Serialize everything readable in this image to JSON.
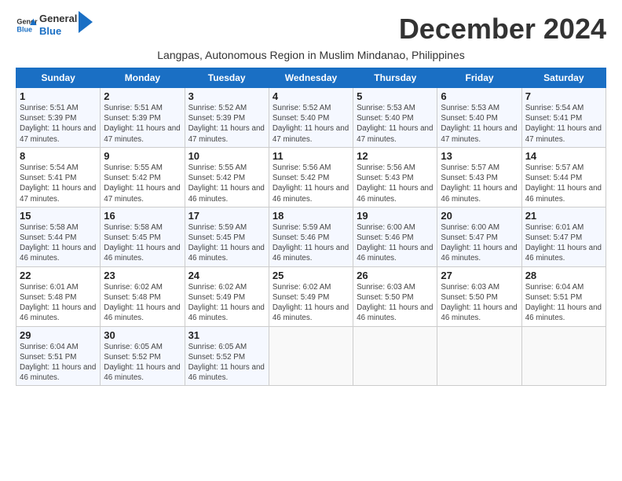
{
  "header": {
    "logo_line1": "General",
    "logo_line2": "Blue",
    "month_title": "December 2024",
    "subtitle": "Langpas, Autonomous Region in Muslim Mindanao, Philippines"
  },
  "weekdays": [
    "Sunday",
    "Monday",
    "Tuesday",
    "Wednesday",
    "Thursday",
    "Friday",
    "Saturday"
  ],
  "weeks": [
    [
      {
        "day": "1",
        "sunrise": "Sunrise: 5:51 AM",
        "sunset": "Sunset: 5:39 PM",
        "daylight": "Daylight: 11 hours and 47 minutes."
      },
      {
        "day": "2",
        "sunrise": "Sunrise: 5:51 AM",
        "sunset": "Sunset: 5:39 PM",
        "daylight": "Daylight: 11 hours and 47 minutes."
      },
      {
        "day": "3",
        "sunrise": "Sunrise: 5:52 AM",
        "sunset": "Sunset: 5:39 PM",
        "daylight": "Daylight: 11 hours and 47 minutes."
      },
      {
        "day": "4",
        "sunrise": "Sunrise: 5:52 AM",
        "sunset": "Sunset: 5:40 PM",
        "daylight": "Daylight: 11 hours and 47 minutes."
      },
      {
        "day": "5",
        "sunrise": "Sunrise: 5:53 AM",
        "sunset": "Sunset: 5:40 PM",
        "daylight": "Daylight: 11 hours and 47 minutes."
      },
      {
        "day": "6",
        "sunrise": "Sunrise: 5:53 AM",
        "sunset": "Sunset: 5:40 PM",
        "daylight": "Daylight: 11 hours and 47 minutes."
      },
      {
        "day": "7",
        "sunrise": "Sunrise: 5:54 AM",
        "sunset": "Sunset: 5:41 PM",
        "daylight": "Daylight: 11 hours and 47 minutes."
      }
    ],
    [
      {
        "day": "8",
        "sunrise": "Sunrise: 5:54 AM",
        "sunset": "Sunset: 5:41 PM",
        "daylight": "Daylight: 11 hours and 47 minutes."
      },
      {
        "day": "9",
        "sunrise": "Sunrise: 5:55 AM",
        "sunset": "Sunset: 5:42 PM",
        "daylight": "Daylight: 11 hours and 47 minutes."
      },
      {
        "day": "10",
        "sunrise": "Sunrise: 5:55 AM",
        "sunset": "Sunset: 5:42 PM",
        "daylight": "Daylight: 11 hours and 46 minutes."
      },
      {
        "day": "11",
        "sunrise": "Sunrise: 5:56 AM",
        "sunset": "Sunset: 5:42 PM",
        "daylight": "Daylight: 11 hours and 46 minutes."
      },
      {
        "day": "12",
        "sunrise": "Sunrise: 5:56 AM",
        "sunset": "Sunset: 5:43 PM",
        "daylight": "Daylight: 11 hours and 46 minutes."
      },
      {
        "day": "13",
        "sunrise": "Sunrise: 5:57 AM",
        "sunset": "Sunset: 5:43 PM",
        "daylight": "Daylight: 11 hours and 46 minutes."
      },
      {
        "day": "14",
        "sunrise": "Sunrise: 5:57 AM",
        "sunset": "Sunset: 5:44 PM",
        "daylight": "Daylight: 11 hours and 46 minutes."
      }
    ],
    [
      {
        "day": "15",
        "sunrise": "Sunrise: 5:58 AM",
        "sunset": "Sunset: 5:44 PM",
        "daylight": "Daylight: 11 hours and 46 minutes."
      },
      {
        "day": "16",
        "sunrise": "Sunrise: 5:58 AM",
        "sunset": "Sunset: 5:45 PM",
        "daylight": "Daylight: 11 hours and 46 minutes."
      },
      {
        "day": "17",
        "sunrise": "Sunrise: 5:59 AM",
        "sunset": "Sunset: 5:45 PM",
        "daylight": "Daylight: 11 hours and 46 minutes."
      },
      {
        "day": "18",
        "sunrise": "Sunrise: 5:59 AM",
        "sunset": "Sunset: 5:46 PM",
        "daylight": "Daylight: 11 hours and 46 minutes."
      },
      {
        "day": "19",
        "sunrise": "Sunrise: 6:00 AM",
        "sunset": "Sunset: 5:46 PM",
        "daylight": "Daylight: 11 hours and 46 minutes."
      },
      {
        "day": "20",
        "sunrise": "Sunrise: 6:00 AM",
        "sunset": "Sunset: 5:47 PM",
        "daylight": "Daylight: 11 hours and 46 minutes."
      },
      {
        "day": "21",
        "sunrise": "Sunrise: 6:01 AM",
        "sunset": "Sunset: 5:47 PM",
        "daylight": "Daylight: 11 hours and 46 minutes."
      }
    ],
    [
      {
        "day": "22",
        "sunrise": "Sunrise: 6:01 AM",
        "sunset": "Sunset: 5:48 PM",
        "daylight": "Daylight: 11 hours and 46 minutes."
      },
      {
        "day": "23",
        "sunrise": "Sunrise: 6:02 AM",
        "sunset": "Sunset: 5:48 PM",
        "daylight": "Daylight: 11 hours and 46 minutes."
      },
      {
        "day": "24",
        "sunrise": "Sunrise: 6:02 AM",
        "sunset": "Sunset: 5:49 PM",
        "daylight": "Daylight: 11 hours and 46 minutes."
      },
      {
        "day": "25",
        "sunrise": "Sunrise: 6:02 AM",
        "sunset": "Sunset: 5:49 PM",
        "daylight": "Daylight: 11 hours and 46 minutes."
      },
      {
        "day": "26",
        "sunrise": "Sunrise: 6:03 AM",
        "sunset": "Sunset: 5:50 PM",
        "daylight": "Daylight: 11 hours and 46 minutes."
      },
      {
        "day": "27",
        "sunrise": "Sunrise: 6:03 AM",
        "sunset": "Sunset: 5:50 PM",
        "daylight": "Daylight: 11 hours and 46 minutes."
      },
      {
        "day": "28",
        "sunrise": "Sunrise: 6:04 AM",
        "sunset": "Sunset: 5:51 PM",
        "daylight": "Daylight: 11 hours and 46 minutes."
      }
    ],
    [
      {
        "day": "29",
        "sunrise": "Sunrise: 6:04 AM",
        "sunset": "Sunset: 5:51 PM",
        "daylight": "Daylight: 11 hours and 46 minutes."
      },
      {
        "day": "30",
        "sunrise": "Sunrise: 6:05 AM",
        "sunset": "Sunset: 5:52 PM",
        "daylight": "Daylight: 11 hours and 46 minutes."
      },
      {
        "day": "31",
        "sunrise": "Sunrise: 6:05 AM",
        "sunset": "Sunset: 5:52 PM",
        "daylight": "Daylight: 11 hours and 46 minutes."
      },
      null,
      null,
      null,
      null
    ]
  ]
}
